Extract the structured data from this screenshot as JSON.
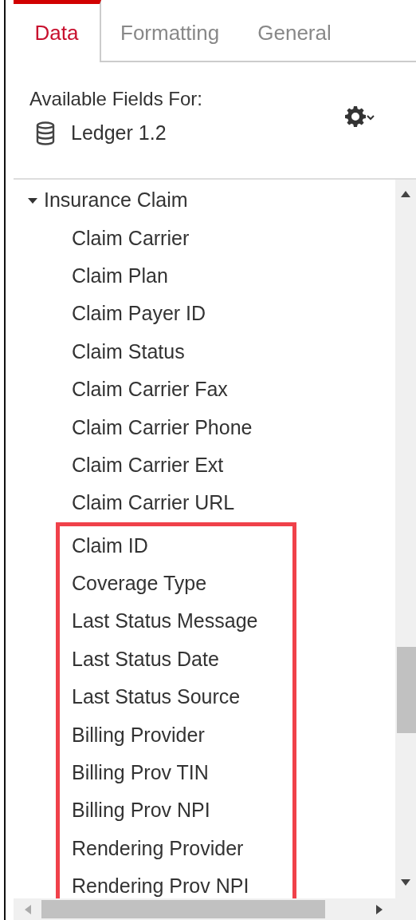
{
  "tabs": [
    {
      "label": "Data",
      "selected": true
    },
    {
      "label": "Formatting",
      "selected": false
    },
    {
      "label": "General",
      "selected": false
    }
  ],
  "header": {
    "title": "Available Fields For:",
    "source": "Ledger 1.2"
  },
  "tree": [
    {
      "label": "Insurance Claim",
      "expanded": true,
      "children": [
        {
          "label": "Claim Carrier",
          "highlighted": false
        },
        {
          "label": "Claim Plan",
          "highlighted": false
        },
        {
          "label": "Claim Payer ID",
          "highlighted": false
        },
        {
          "label": "Claim Status",
          "highlighted": false
        },
        {
          "label": "Claim Carrier Fax",
          "highlighted": false
        },
        {
          "label": "Claim Carrier Phone",
          "highlighted": false
        },
        {
          "label": "Claim Carrier Ext",
          "highlighted": false
        },
        {
          "label": "Claim Carrier URL",
          "highlighted": false
        },
        {
          "label": "Claim ID",
          "highlighted": true
        },
        {
          "label": "Coverage Type",
          "highlighted": true
        },
        {
          "label": "Last Status Message",
          "highlighted": true
        },
        {
          "label": "Last Status Date",
          "highlighted": true
        },
        {
          "label": "Last Status Source",
          "highlighted": true
        },
        {
          "label": "Billing Provider",
          "highlighted": true
        },
        {
          "label": "Billing Prov TIN",
          "highlighted": true
        },
        {
          "label": "Billing Prov NPI",
          "highlighted": true
        },
        {
          "label": "Rendering Provider",
          "highlighted": true
        },
        {
          "label": "Rendering Prov NPI",
          "highlighted": true
        }
      ]
    }
  ]
}
